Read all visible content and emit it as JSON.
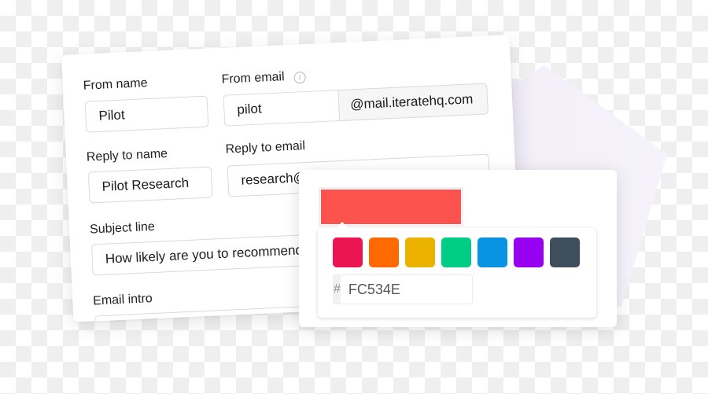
{
  "form": {
    "from_name": {
      "label": "From name",
      "value": "Pilot"
    },
    "from_email": {
      "label": "From email",
      "value": "pilot",
      "domain_suffix": "@mail.iteratehq.com",
      "info_icon": "info-icon"
    },
    "reply_to_name": {
      "label": "Reply to name",
      "value": "Pilot Research"
    },
    "reply_to_email": {
      "label": "Reply to email",
      "value": "research@"
    },
    "subject_line": {
      "label": "Subject line",
      "value": "How likely are you to recommend"
    },
    "email_intro": {
      "label": "Email intro",
      "value": ""
    }
  },
  "color_picker": {
    "selected_color": "#FC534E",
    "hex_prefix": "#",
    "hex_value": "FC534E",
    "swatches": [
      {
        "name": "crimson",
        "color": "#EC1551"
      },
      {
        "name": "orange",
        "color": "#FF6A00"
      },
      {
        "name": "amber",
        "color": "#EBB200"
      },
      {
        "name": "green",
        "color": "#00CD85"
      },
      {
        "name": "blue",
        "color": "#0993E3"
      },
      {
        "name": "purple",
        "color": "#9700F0"
      },
      {
        "name": "slate",
        "color": "#3F4E5C"
      }
    ]
  },
  "decor": {
    "backdrop_color": "#F4F1FA"
  }
}
